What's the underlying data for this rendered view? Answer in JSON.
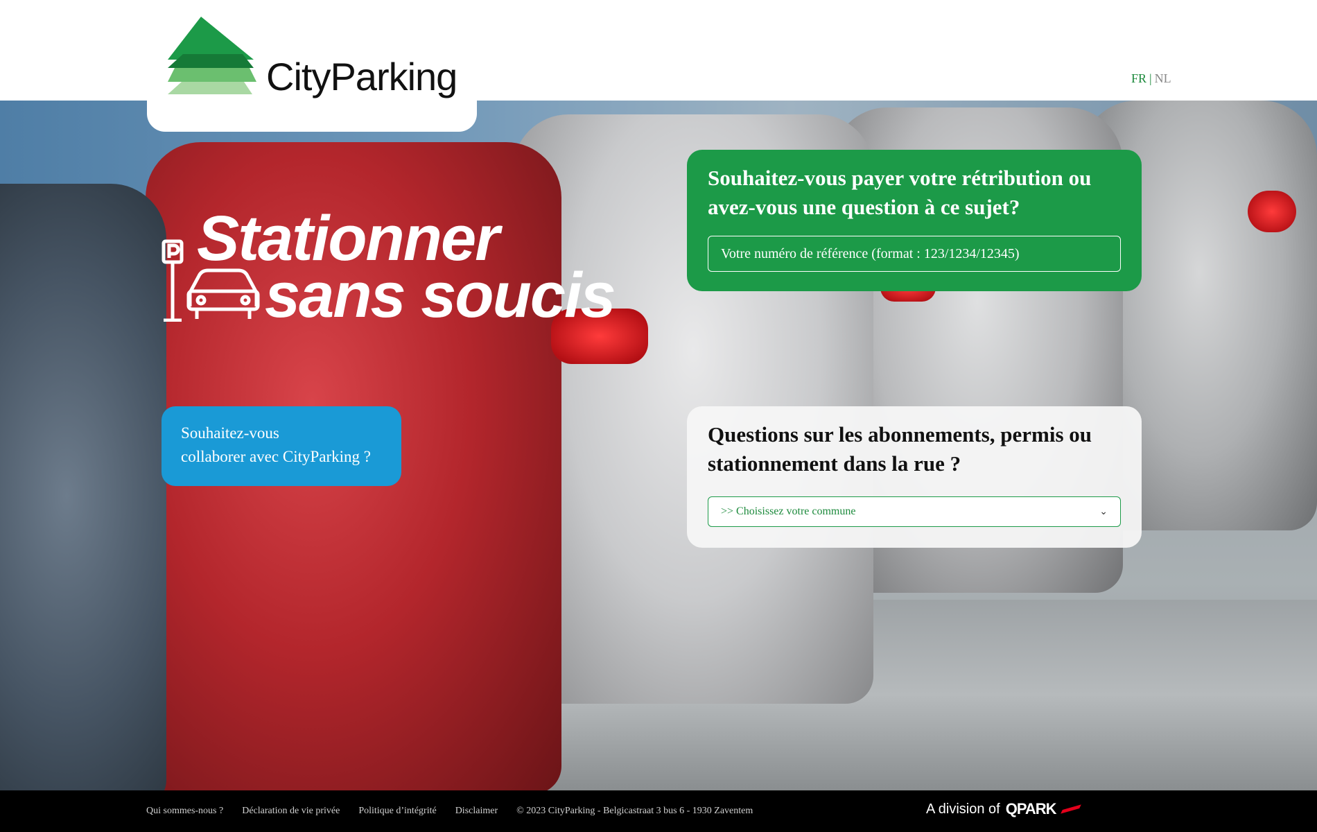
{
  "header": {
    "brand_name": "CityParking",
    "languages": {
      "fr": "FR",
      "separator": "|",
      "nl": "NL"
    }
  },
  "hero": {
    "title_line1": "Stationner",
    "title_line2": "sans soucis",
    "collaborate_line1": "Souhaitez-vous",
    "collaborate_line2": "collaborer avec CityParking ?"
  },
  "pay_card": {
    "title": "Souhaitez-vous payer votre rétribution ou avez-vous une question à ce sujet?",
    "input_placeholder": "Votre numéro de référence (format : 123/1234/12345)"
  },
  "questions_card": {
    "title": "Questions sur les abonnements, permis ou stationnement dans la rue ?",
    "select_value": ">> Choisissez votre commune"
  },
  "footer": {
    "links": [
      "Qui sommes-nous ?",
      "Déclaration de vie privée",
      "Politique d’intégrité",
      "Disclaimer"
    ],
    "copyright": "© 2023 CityParking - Belgicastraat 3 bus 6 - 1930 Zaventem",
    "division_text": "A division of",
    "division_brand": "QPARK"
  },
  "colors": {
    "brand_green": "#1c9a48",
    "collab_blue": "#1a9ad6",
    "footer_bg": "#000000"
  }
}
